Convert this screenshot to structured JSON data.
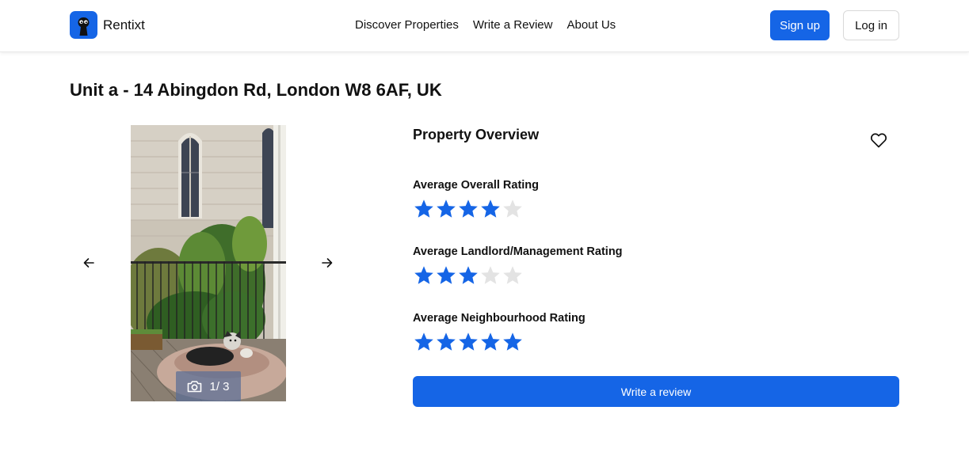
{
  "brand": {
    "name": "Rentixt"
  },
  "nav": [
    "Discover Properties",
    "Write a Review",
    "About Us"
  ],
  "auth": {
    "signup_label": "Sign up",
    "login_label": "Log in"
  },
  "property": {
    "address": "Unit a - 14 Abingdon Rd, London W8 6AF, UK"
  },
  "gallery": {
    "counter": "1/ 3",
    "current": 1,
    "total": 3
  },
  "overview": {
    "title": "Property Overview",
    "ratings": [
      {
        "label": "Average Overall Rating",
        "value": 4,
        "max": 5
      },
      {
        "label": "Average Landlord/Management Rating",
        "value": 3,
        "max": 5
      },
      {
        "label": "Average Neighbourhood Rating",
        "value": 5,
        "max": 5
      }
    ],
    "write_review_label": "Write a review"
  },
  "colors": {
    "accent": "#1565e6",
    "star_empty": "#e3e3e3"
  },
  "icons": [
    "keyhole-logo-icon",
    "arrow-left-icon",
    "arrow-right-icon",
    "camera-icon",
    "heart-icon",
    "star-icon"
  ]
}
